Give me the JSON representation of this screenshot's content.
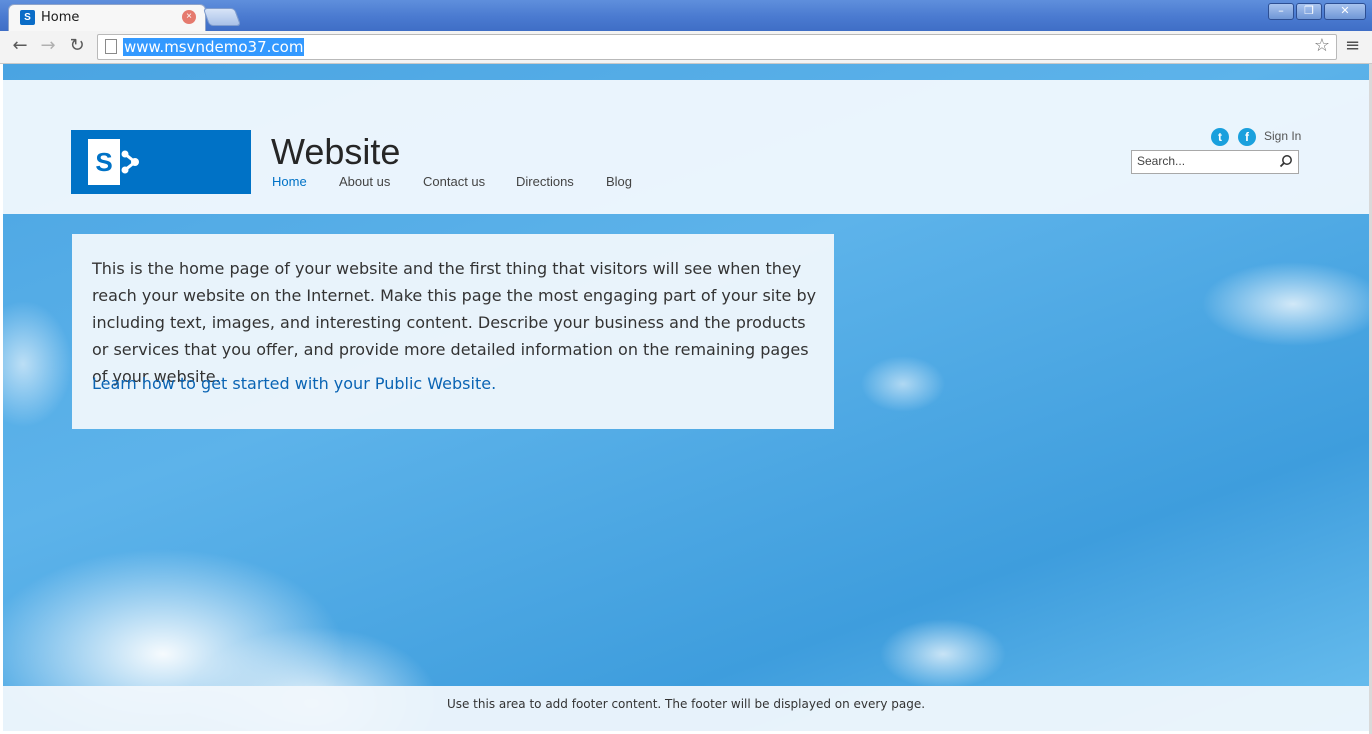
{
  "browser": {
    "tab": {
      "title": "Home",
      "favicon_letter": "S"
    },
    "address_bar": {
      "url": "www.msvndemo37.com"
    },
    "icons": {
      "back": "arrow-left-icon",
      "forward": "arrow-right-icon",
      "reload": "reload-icon",
      "bookmark": "star-icon",
      "menu": "hamburger-menu-icon",
      "page": "page-icon"
    }
  },
  "site": {
    "title": "Website",
    "logo_letter": "S",
    "nav": [
      {
        "label": "Home",
        "active": true
      },
      {
        "label": "About us",
        "active": false
      },
      {
        "label": "Contact us",
        "active": false
      },
      {
        "label": "Directions",
        "active": false
      },
      {
        "label": "Blog",
        "active": false
      }
    ],
    "social": {
      "twitter_glyph": "t",
      "facebook_glyph": "f"
    },
    "sign_in": "Sign In",
    "search_placeholder": "Search..."
  },
  "content": {
    "body": "This is the home page of your website and the first thing that visitors will see when they reach your website on the Internet. Make this page the most engaging part of your site by including text, images, and interesting content. Describe your business and the products or services that you offer, and provide more detailed information on the remaining pages of your website.",
    "link": "Learn how to get started with your Public Website."
  },
  "footer": {
    "text": "Use this area to add footer content. The footer will be displayed on every page."
  },
  "colors": {
    "brand_blue": "#0072c6",
    "link_blue": "#0a64b4",
    "sky": "#4aa4e2"
  }
}
